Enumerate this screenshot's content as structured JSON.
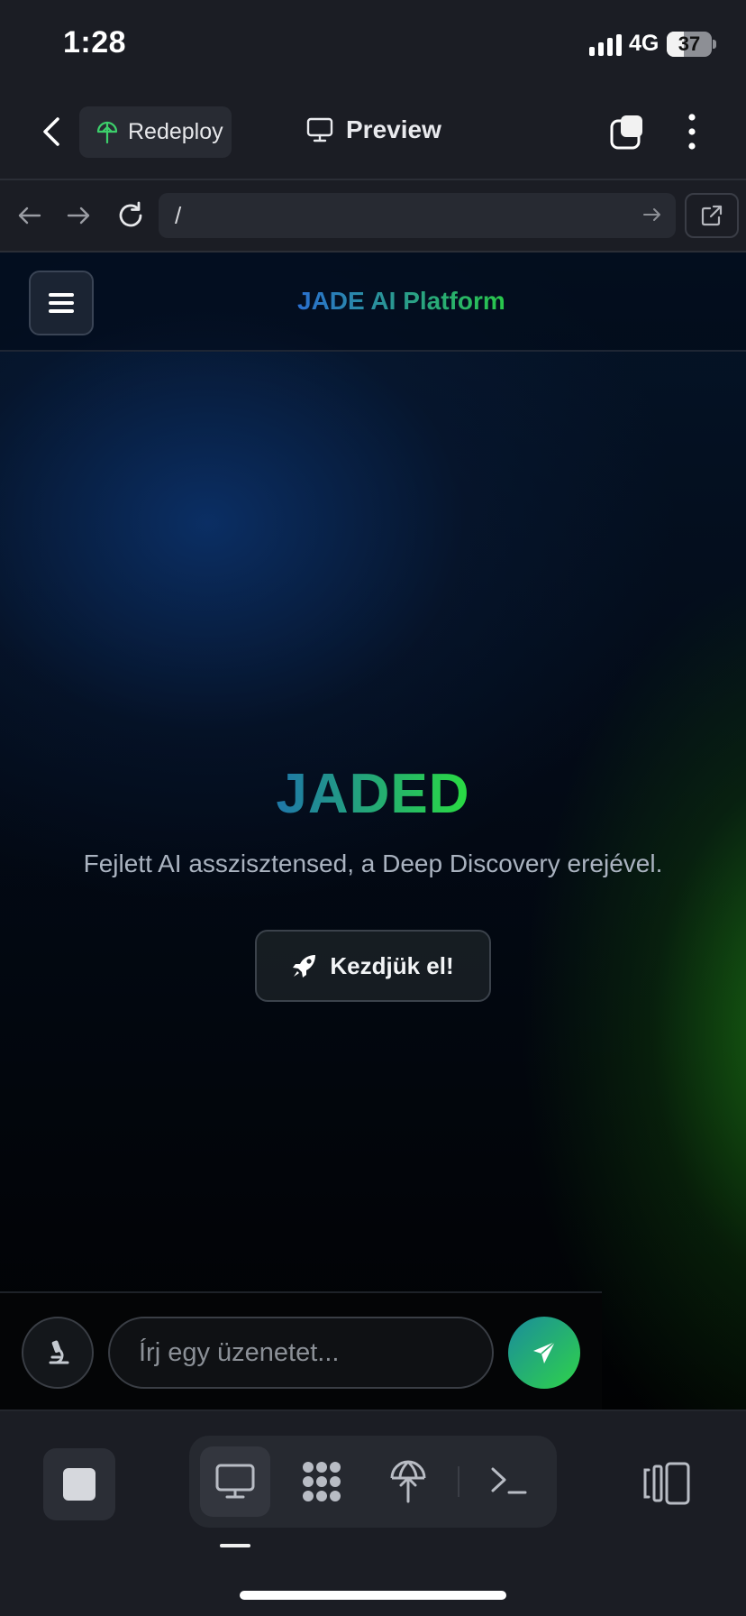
{
  "status_bar": {
    "time": "1:28",
    "network": "4G",
    "battery": "37",
    "battery_level": 0.37
  },
  "header": {
    "redeploy_label": "Redeploy",
    "title": "Preview"
  },
  "browser": {
    "url": "/"
  },
  "site": {
    "title": "JADE AI Platform",
    "hero_title": "JADED",
    "hero_subtitle": "Fejlett AI asszisztensed, a Deep Discovery erejével.",
    "cta_label": "Kezdjük el!"
  },
  "chat": {
    "placeholder": "Írj egy üzenetet..."
  },
  "colors": {
    "accent_blue": "#2a6fd0",
    "accent_green": "#29c84a",
    "app_bg": "#1b1d24"
  },
  "icons": {
    "header": [
      "chevron-left-icon",
      "umbrella-deploy-icon",
      "monitor-icon",
      "tabs-icon",
      "more-vertical-icon"
    ],
    "browser": [
      "arrow-left-icon",
      "arrow-right-icon",
      "reload-icon",
      "go-arrow-icon",
      "external-link-icon"
    ],
    "site": [
      "hamburger-menu-icon",
      "rocket-icon",
      "microscope-icon",
      "send-icon"
    ],
    "toolbar": [
      "stop-icon",
      "monitor-icon",
      "grid-dots-icon",
      "globe-upload-icon",
      "terminal-icon",
      "split-layout-icon"
    ]
  }
}
